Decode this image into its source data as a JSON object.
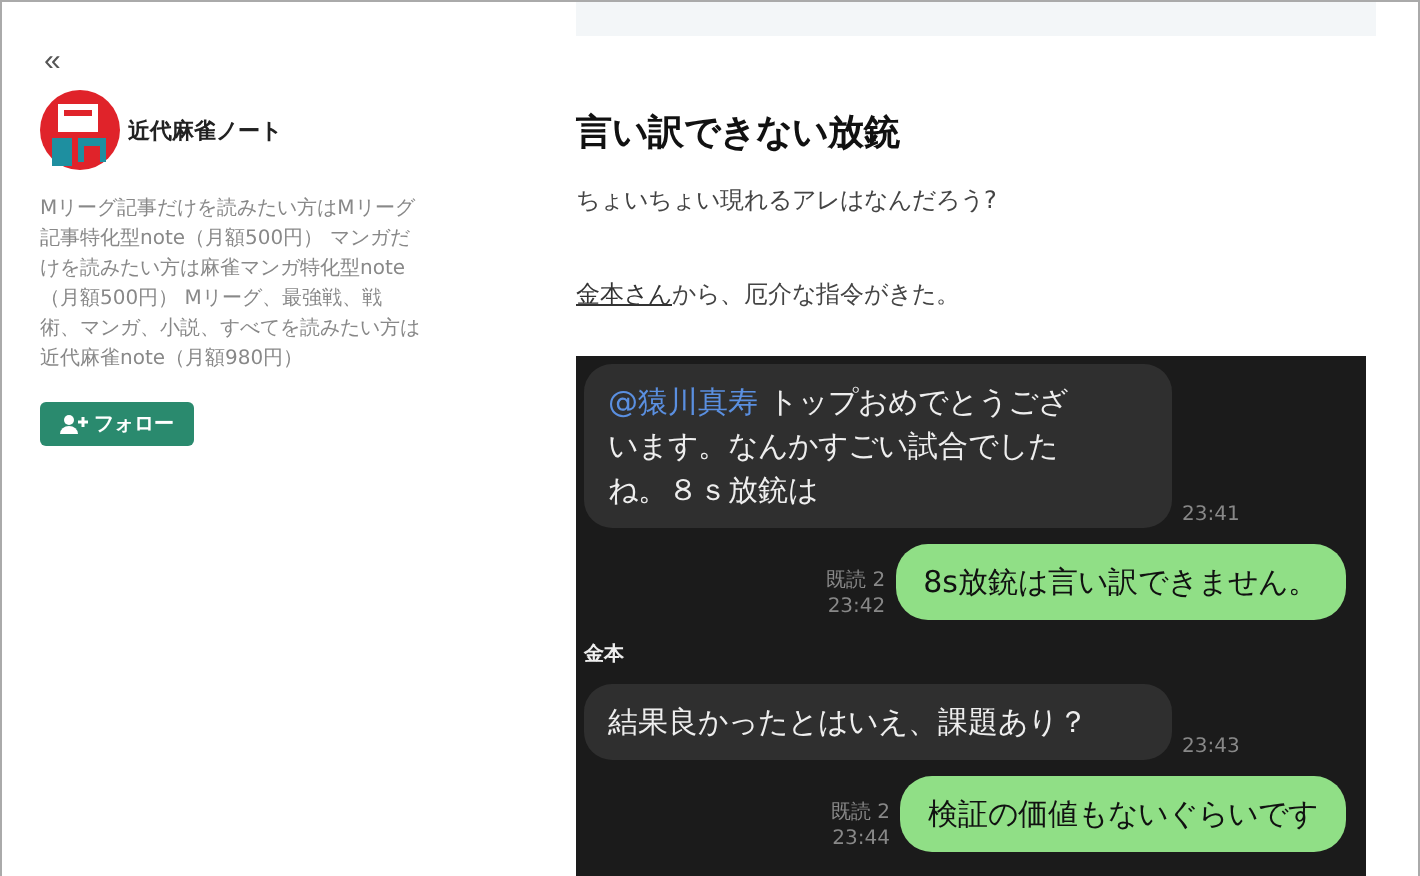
{
  "sidebar": {
    "collapse_icon": "«",
    "name": "近代麻雀ノート",
    "description": "Mリーグ記事だけを読みたい方はMリーグ記事特化型note（月額500円） マンガだけを読みたい方は麻雀マンガ特化型note（月額500円） Mリーグ、最強戦、戦術、マンガ、小説、すべてを読みたい方は近代麻雀note（月額980円）",
    "follow_button": "フォロー"
  },
  "article": {
    "title": "言い訳できない放銃",
    "lead": "ちょいちょい現れるアレはなんだろう?",
    "paragraph_link": "金本さん",
    "paragraph_rest": "から、厄介な指令がきた。",
    "chat": [
      {
        "kind": "incoming",
        "mention": "@猿川真寿",
        "text": "トップおめでとうございます。なんかすごい試合でしたね。８ｓ放銃は",
        "time": "23:41"
      },
      {
        "kind": "outgoing",
        "read": "既読 2",
        "time": "23:42",
        "text": "8s放銃は言い訳できません。"
      },
      {
        "kind": "sender",
        "text": "金本"
      },
      {
        "kind": "incoming",
        "text": "結果良かったとはいえ、課題あり？",
        "time": "23:43"
      },
      {
        "kind": "outgoing",
        "read": "既読 2",
        "time": "23:44",
        "text": "検証の価値もないぐらいです"
      }
    ]
  }
}
